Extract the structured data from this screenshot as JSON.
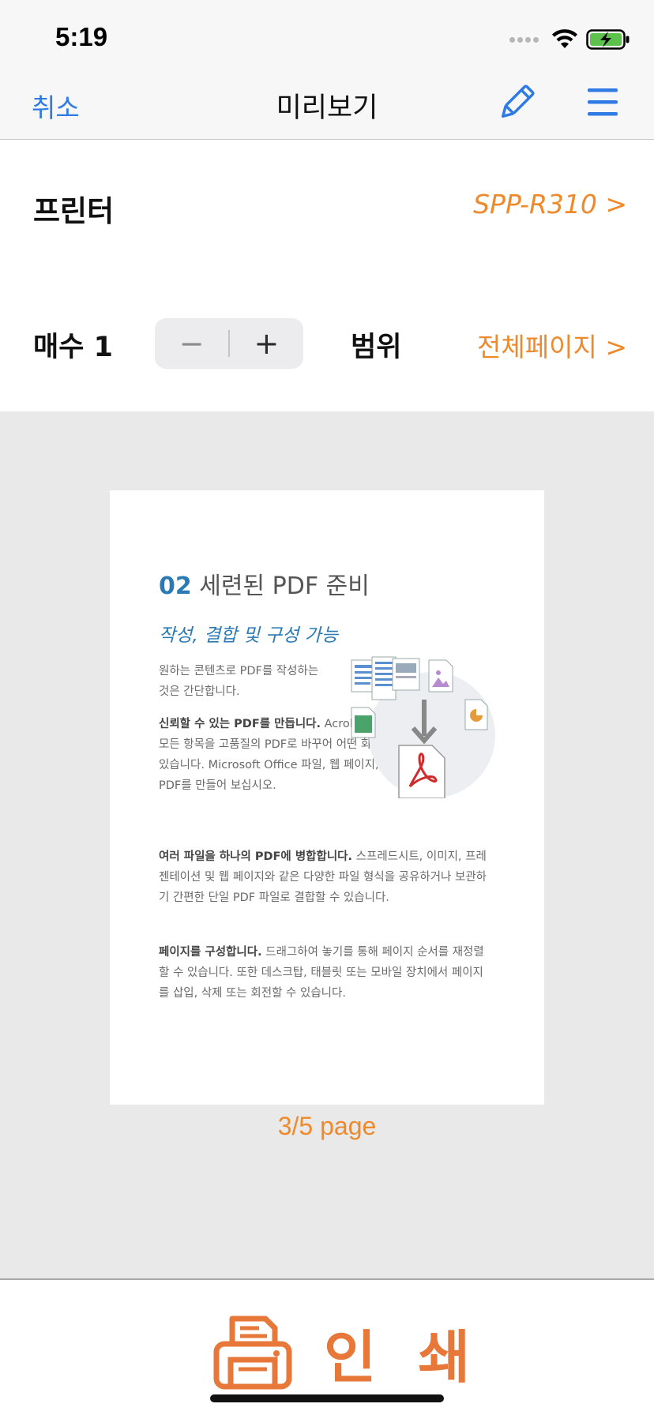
{
  "status_bar": {
    "time": "5:19"
  },
  "nav": {
    "cancel_label": "취소",
    "title": "미리보기",
    "edit_icon": "pencil-icon",
    "menu_icon": "hamburger-menu-icon"
  },
  "settings": {
    "printer_label": "프린터",
    "printer_value": "SPP-R310 >",
    "copies_label": "매수 1",
    "stepper_minus": "−",
    "stepper_plus": "+",
    "range_label": "범위",
    "range_value": "전체페이지 >"
  },
  "preview": {
    "heading_num": "02",
    "heading_text": " 세련된 PDF 준비",
    "subheading": "작성, 결합 및 구성 가능",
    "p1": "원하는 콘텐츠로 PDF를 작성하는 것은 간단합니다.",
    "p2_bold": "신뢰할 수 있는 PDF를 만듭니다.",
    "p2_text": " Acrobat을 사용하면 실질적으로 모든 항목을 고품질의 PDF로 바꾸어 어떤 화면에서도 훌륭하게 볼 수 있습니다. Microsoft Office 파일, 웹 페이지, 스캔한 문서 등으로 PDF를 만들어 보십시오.",
    "p3_bold": "여러 파일을 하나의 PDF에 병합합니다.",
    "p3_text": " 스프레드시트, 이미지, 프레젠테이션 및 웹 페이지와 같은 다양한 파일 형식을 공유하거나 보관하기 간편한 단일 PDF 파일로 결합할 수 있습니다.",
    "p4_bold": "페이지를 구성합니다.",
    "p4_text": " 드래그하여 놓기를 통해 페이지 순서를 재정렬할 수 있습니다. 또한 데스크탑, 태블릿 또는 모바일 장치에서 페이지를 삽입, 삭제 또는 회전할 수 있습니다.",
    "page_counter": "3/5 page"
  },
  "print": {
    "label": "인 쇄",
    "icon": "printer-icon"
  },
  "colors": {
    "accent_orange": "#ef8a2c",
    "link_blue": "#2f7ae5",
    "preview_bg": "#e9e9e9"
  }
}
